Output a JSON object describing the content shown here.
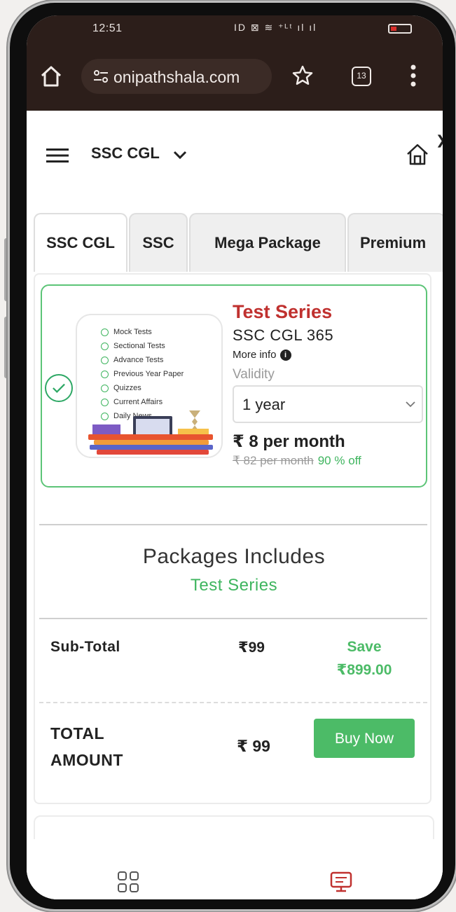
{
  "status_bar": {
    "time": "12:51",
    "icons": "ID ⊠ ≋ ⁺ᴸᵗ ıl ıl"
  },
  "browser": {
    "url": "onipathshala.com",
    "tab_count": "13"
  },
  "header": {
    "title": "SSC CGL"
  },
  "tabs": [
    {
      "label": "SSC CGL",
      "active": true
    },
    {
      "label": "SSC",
      "active": false
    },
    {
      "label": "Mega Package",
      "active": false
    },
    {
      "label": "Premium",
      "active": false
    }
  ],
  "package": {
    "thumbnail_items": [
      "Mock Tests",
      "Sectional Tests",
      "Advance Tests",
      "Previous Year Paper",
      "Quizzes",
      "Current Affairs",
      "Daily News"
    ],
    "type": "Test Series",
    "name": "SSC CGL 365",
    "more_info": "More info",
    "validity_label": "Validity",
    "validity_value": "1 year",
    "price": "₹ 8 per month",
    "old_price": "₹ 82 per month",
    "discount": "90 % off"
  },
  "includes": {
    "title": "Packages Includes",
    "item": "Test Series"
  },
  "summary": {
    "subtotal_label": "Sub-Total",
    "subtotal_value": "₹99",
    "save_label": "Save",
    "save_value": "₹899.00",
    "total_label_1": "TOTAL",
    "total_label_2": "AMOUNT",
    "total_value": "₹ 99",
    "buy_label": "Buy Now"
  },
  "colors": {
    "accent": "#4cbb67",
    "title_red": "#c0312f",
    "browser_bg": "#2c1e1a"
  }
}
